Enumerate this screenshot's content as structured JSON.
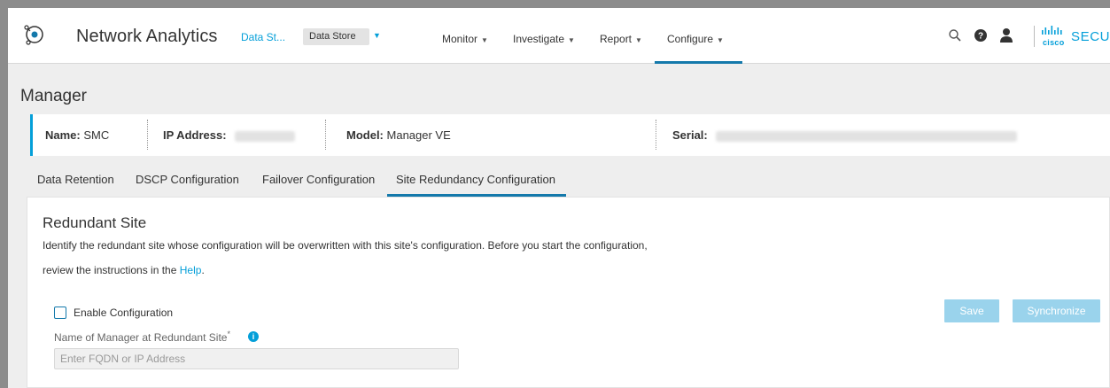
{
  "header": {
    "app_title": "Network Analytics",
    "datastore_link": "Data St...",
    "datastore_select": "Data Store",
    "nav": [
      {
        "label": "Monitor"
      },
      {
        "label": "Investigate"
      },
      {
        "label": "Report"
      },
      {
        "label": "Configure"
      }
    ],
    "active_nav": "Configure",
    "brand_small": "cisco",
    "brand": "SECURE"
  },
  "page": {
    "title": "Manager"
  },
  "info": {
    "name_label": "Name:",
    "name_value": "SMC",
    "ip_label": "IP Address:",
    "model_label": "Model:",
    "model_value": "Manager VE",
    "serial_label": "Serial:"
  },
  "tabs": [
    {
      "label": "Data Retention"
    },
    {
      "label": "DSCP Configuration"
    },
    {
      "label": "Failover Configuration"
    },
    {
      "label": "Site Redundancy Configuration"
    }
  ],
  "active_tab": "Site Redundancy Configuration",
  "section": {
    "title": "Redundant Site",
    "desc_line1": "Identify the redundant site whose configuration will be overwritten with this site's configuration. Before you start the configuration,",
    "desc_line2_prefix": "review the instructions in the ",
    "help_link": "Help",
    "desc_line2_suffix": ".",
    "enable_label": "Enable Configuration",
    "enable_checked": false,
    "save_label": "Save",
    "sync_label": "Synchronize",
    "field_label": "Name of Manager at Redundant Site",
    "required_mark": "*",
    "info_icon_glyph": "i",
    "field_placeholder": "Enter FQDN or IP Address"
  },
  "colors": {
    "accent": "#049fd9",
    "active_underline": "#1479ab",
    "disabled_button": "#9ad3ec"
  },
  "icons": [
    "app-logo-icon",
    "search-icon",
    "help-icon",
    "user-icon",
    "cisco-logo-icon",
    "info-icon"
  ]
}
